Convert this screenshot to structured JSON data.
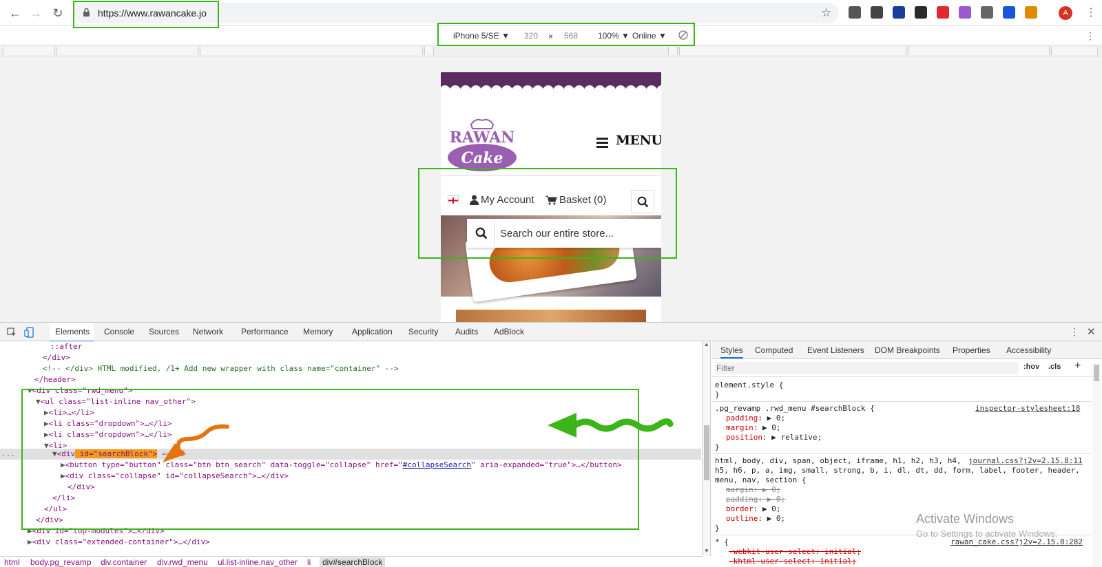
{
  "browser": {
    "url": "https://www.rawancake.jo",
    "avatar_letter": "A",
    "menu_icon": "⋮",
    "extensions": [
      {
        "name": "settings-ext-icon",
        "color": "#555"
      },
      {
        "name": "eyedropper-ext-icon",
        "color": "#444"
      },
      {
        "name": "news-ext-icon",
        "color": "#1a3c9c"
      },
      {
        "name": "checklist-ext-icon",
        "color": "#2b2b2b"
      },
      {
        "name": "opera-ext-icon",
        "color": "#e0282e"
      },
      {
        "name": "feather-ext-icon",
        "color": "#9b59d0"
      },
      {
        "name": "screen-ext-icon",
        "color": "#666"
      },
      {
        "name": "save-ext-icon",
        "color": "#1a56db"
      },
      {
        "name": "puzzle-ext-icon",
        "color": "#e08a00"
      }
    ]
  },
  "device_toolbar": {
    "device": "iPhone 5/SE",
    "width": "320",
    "times": "×",
    "height": "568",
    "zoom": "100%",
    "network": "Online"
  },
  "site": {
    "logo_line1": "RAWAN",
    "logo_line2": "Cake",
    "menu_label": "MENU",
    "account_label": "My Account",
    "basket_label": "Basket (0)",
    "search_placeholder": "Search our entire store..."
  },
  "devtools": {
    "tabs": [
      "Elements",
      "Console",
      "Sources",
      "Network",
      "Performance",
      "Memory",
      "Application",
      "Security",
      "Audits",
      "AdBlock"
    ],
    "style_tabs": [
      "Styles",
      "Computed",
      "Event Listeners",
      "DOM Breakpoints",
      "Properties",
      "Accessibility"
    ],
    "filter_placeholder": "Filter",
    "hov": ":hov",
    "cls": ".cls",
    "breadcrumbs": [
      "html",
      "body.pg_revamp",
      "div.container",
      "div.rwd_menu",
      "ul.list-inline.nav_other",
      "li",
      "div#searchBlock"
    ],
    "dom": {
      "after": "::after",
      "close_div": "</div>",
      "comment": "<!-- </div> HTML modified, /1+ Add new wrapper with class name=\"container\" -->",
      "close_header": "</header>",
      "rwd_open": "<div class=\"rwd_menu\">",
      "ul_open": "<ul class=\"list-inline nav_other\">",
      "li1": "<li>…</li>",
      "li_dd1": "<li class=\"dropdown\">…</li>",
      "li_dd2": "<li class=\"dropdown\">…</li>",
      "li_open": "<li>",
      "sel_pre": "<div",
      "sel_id": " id=\"searchBlock\">",
      "sel_suffix": " == $0",
      "btn_pre": "<button type=\"button\" class=\"btn btn_search\" data-toggle=\"collapse\" href=\"",
      "btn_href": "#collapseSearch",
      "btn_post": "\" aria-expanded=\"true\">…</button>",
      "collapse": "<div class=\"collapse\" id=\"collapseSearch\">…</div>",
      "close_div2": "</div>",
      "close_li": "</li>",
      "close_ul": "</ul>",
      "close_div3": "</div>",
      "top_modules": "<div id=\"top-modules\">…</div>",
      "extended": "<div class=\"extended-container\">…</div>",
      "dots": "..."
    },
    "styles": {
      "element_style": "element.style {",
      "close_brace": "}",
      "rule1_selector": ".pg_revamp .rwd_menu #searchBlock {",
      "rule1_source": "inspector-stylesheet:18",
      "rule1_props": [
        {
          "name": "padding",
          "value": "0;"
        },
        {
          "name": "margin",
          "value": "0;"
        },
        {
          "name": "position",
          "value": "relative;"
        }
      ],
      "rule2_selector_1": "html, body, div, span, object, iframe, h1, h2, h3, h4,",
      "rule2_selector_2": "h5, h6, p, a, img, small, strong, b, i, dl, dt, dd, form, label, footer, header,",
      "rule2_selector_3": "menu, nav, section {",
      "rule2_source": "journal.css?j2v=2.15.8:11",
      "rule2_props": [
        {
          "name": "margin",
          "value": "0;",
          "struck": true
        },
        {
          "name": "padding",
          "value": "0;",
          "struck": true
        },
        {
          "name": "border",
          "value": "0;",
          "struck": false
        },
        {
          "name": "outline",
          "value": "0;",
          "struck": false
        }
      ],
      "rule3_selector": "* {",
      "rule3_source": "rawan_cake.css?j2v=2.15.8:282",
      "rule3_prop1": "-webkit-user-select: initial;",
      "rule3_prop2": "-khtml-user-select: initial;"
    },
    "watermark_title": "Activate Windows",
    "watermark_sub": "Go to Settings to activate Windows."
  },
  "colors": {
    "annotation_green": "#3bb517",
    "annotation_orange": "#e8730c",
    "brand_purple": "#5b2c5f",
    "logo_purple": "#9a5fb0"
  }
}
